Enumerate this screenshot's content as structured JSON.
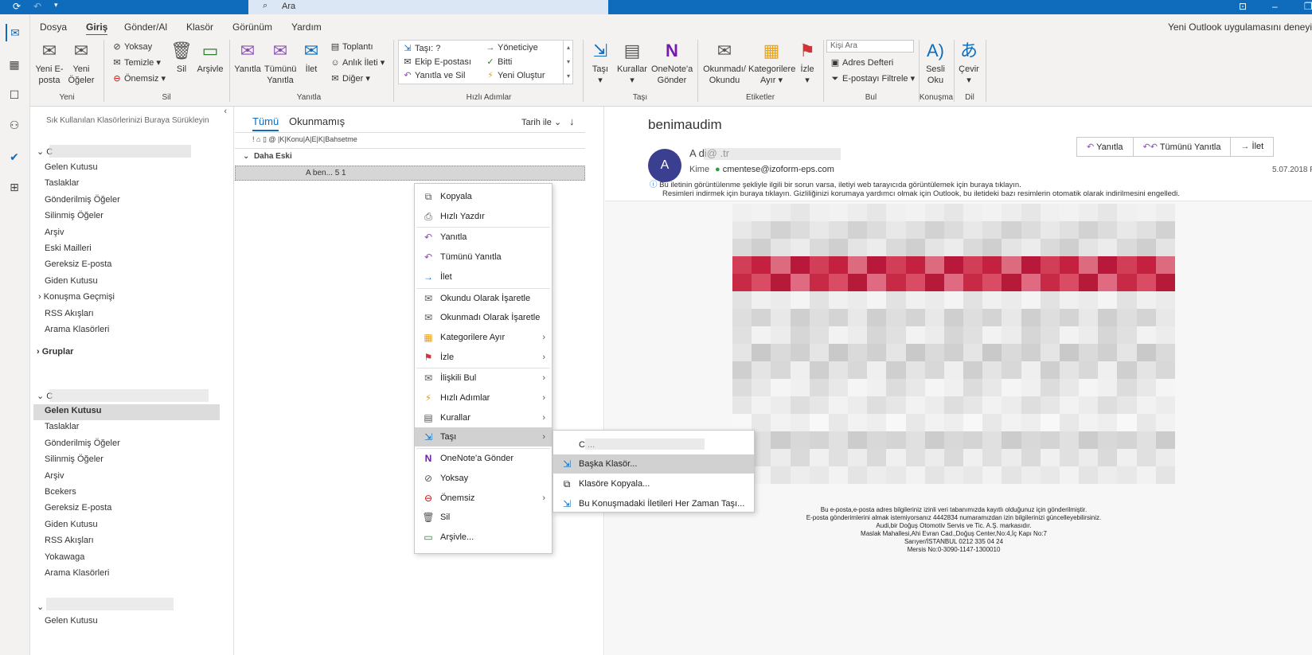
{
  "titlebar": {
    "search_placeholder": "Ara"
  },
  "tabs": [
    "Dosya",
    "Giriş",
    "Gönder/Al",
    "Klasör",
    "Görünüm",
    "Yardım"
  ],
  "promo": "Yeni Outlook uygulamasını deneyi",
  "ribbon": {
    "new_email": "Yeni E-\nposta",
    "new_items": "Yeni Öğeler",
    "ignore": "Yoksay",
    "cleanup": "Temizle",
    "junk": "Önemsiz",
    "delete": "Sil",
    "archive": "Arşivle",
    "reply": "Yanıtla",
    "reply_all": "Tümünü Yanıtla",
    "forward": "İlet",
    "meeting": "Toplantı",
    "im": "Anlık İleti",
    "more": "Diğer",
    "qs": [
      "Taşı: ?",
      "Yöneticiye",
      "Ekip E-postası",
      "Bitti",
      "Yanıtla ve Sil",
      "Yeni Oluştur"
    ],
    "move": "Taşı",
    "rules": "Kurallar",
    "onenote": "OneNote'a Gönder",
    "read_unread": "Okunmadı/ Okundu",
    "categorize": "Kategorilere Ayır",
    "follow": "İzle",
    "people_search": "Kişi Ara",
    "address_book": "Adres Defteri",
    "filter_email": "E-postayı Filtrele",
    "read_aloud": "Sesli Oku",
    "translate": "Çevir",
    "groups": [
      "Yeni",
      "Sil",
      "Yanıtla",
      "Hızlı Adımlar",
      "Taşı",
      "Etiketler",
      "Bul",
      "Konuşma",
      "Dil"
    ]
  },
  "folders": {
    "drop_hint": "Sık Kullanılan Klasörlerinizi Buraya Sürükleyin",
    "account1_initial": "C",
    "account1": [
      "Gelen Kutusu",
      "Taslaklar",
      "Gönderilmiş Öğeler",
      "Silinmiş Öğeler",
      "Arşiv",
      "Eski Mailleri",
      "Gereksiz E-posta",
      "Giden Kutusu",
      "Konuşma Geçmişi",
      "RSS Akışları",
      "Arama Klasörleri"
    ],
    "groups": "Gruplar",
    "account2_initial": "C",
    "account2": [
      "Gelen Kutusu",
      "Taslaklar",
      "Gönderilmiş Öğeler",
      "Silinmiş Öğeler",
      "Arşiv",
      "Bcekers",
      "Gereksiz E-posta",
      "Giden Kutusu",
      "RSS Akışları",
      "Yokawaga",
      "Arama Klasörleri"
    ],
    "account3_first": "Gelen Kutusu"
  },
  "msglist": {
    "filter_all": "Tümü",
    "filter_unread": "Okunmamış",
    "sort": "Tarih ile",
    "col_subject": "Konu",
    "col_mention": "Bahsetme",
    "col_k": "K",
    "col_a": "A",
    "col_e": "E",
    "col_k2": "K",
    "group": "Daha Eski",
    "row": "A ben... 5 1"
  },
  "reading": {
    "subject": "benimaudim",
    "avatar": "A",
    "sender": "A  di@  .tr",
    "to_label": "Kime",
    "to": "cmentese@izoform-eps.com",
    "date": "5.07.2018 P",
    "reply": "Yanıtla",
    "reply_all": "Tümünü Yanıtla",
    "forward": "İlet",
    "info1": "Bu iletinin görüntülenme şekliyle ilgili bir sorun varsa, iletiyi web tarayıcıda görüntülemek için buraya tıklayın.",
    "info2": "Resimleri indirmek için buraya tıklayın. Gizliliğinizi korumaya yardımcı olmak için Outlook, bu iletideki bazı resimlerin otomatik olarak indirilmesini engelledi.",
    "footer": [
      "Bu e-posta,e-posta adres bilgileriniz izinli veri tabanımızda kayıtlı olduğunuz için gönderilmiştir.",
      "E-posta gönderimlerini almak istemiyorsanız 4442834 numaramızdan izin bilgilerinizi güncelleyebilirsiniz.",
      "Audi,bir Doğuş Otomotiv Servis ve Tic. A.Ş. markasıdır.",
      "Maslak Mahallesi,Ahi Evran Cad.,Doğuş Center,No:4,İç Kapı No:7",
      "Sarıyer/İSTANBUL 0212 335 04 24",
      "Mersis No:0-3090-1147-1300010"
    ]
  },
  "context_menu": [
    "Kopyala",
    "Hızlı Yazdır",
    "Yanıtla",
    "Tümünü Yanıtla",
    "İlet",
    "Okundu Olarak İşaretle",
    "Okunmadı Olarak İşaretle",
    "Kategorilere Ayır",
    "İzle",
    "İlişkili Bul",
    "Hızlı Adımlar",
    "Kurallar",
    "Taşı",
    "OneNote'a Gönder",
    "Yoksay",
    "Önemsiz",
    "Sil",
    "Arşivle..."
  ],
  "submenu": {
    "first": "C ...",
    "other_folder": "Başka Klasör...",
    "copy_folder": "Klasöre Kopyala...",
    "always_move": "Bu Konuşmadaki İletileri Her Zaman Taşı..."
  },
  "colors": {
    "accent": "#0f6cbd",
    "highlight": "#d1d1d1",
    "banner_red": "#c4203f"
  }
}
